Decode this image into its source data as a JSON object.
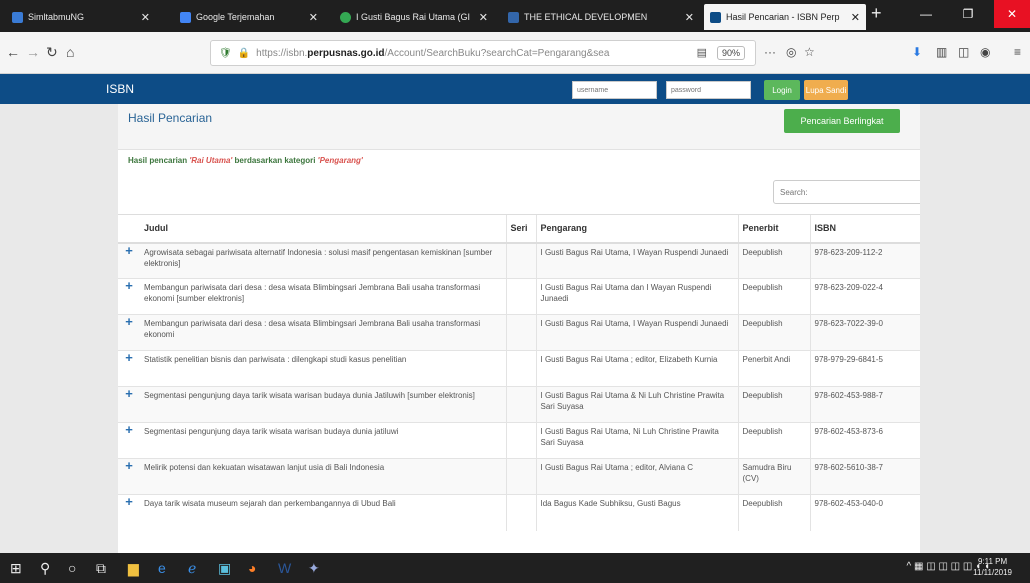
{
  "browser": {
    "tabs": [
      {
        "label": "SimltabmuNG",
        "color": "#3a7bd5"
      },
      {
        "label": "Google Terjemahan",
        "color": "#4285f4"
      },
      {
        "label": "I Gusti Bagus Rai Utama (GI",
        "color": "#34a853"
      },
      {
        "label": "THE ETHICAL DEVELOPMEN",
        "color": "#3366aa"
      },
      {
        "label": "Hasil Pencarian - ISBN Perp",
        "color": "#0d4c86"
      }
    ],
    "new_tab": "+",
    "url_host": "perpusnas.go.id",
    "url_prefix": "https://isbn.",
    "url_path": "/Account/SearchBuku?searchCat=Pengarang&sea",
    "zoom": "90%"
  },
  "header": {
    "brand": "ISBN",
    "username_placeholder": "username",
    "password_placeholder": "password",
    "login_label": "Login",
    "register_label": "Lupa Sandi"
  },
  "panel": {
    "title": "Hasil Pencarian",
    "advanced_button": "Pencarian Berlingkat",
    "result_prefix": "Hasil pencarian ",
    "result_query": "'Rai Utama'",
    "result_mid": " berdasarkan kategori ",
    "result_category": "'Pengarang'",
    "search_placeholder": "Search:"
  },
  "table": {
    "headers": {
      "judul": "Judul",
      "seri": "Seri",
      "pengarang": "Pengarang",
      "penerbit": "Penerbit",
      "isbn": "ISBN"
    },
    "rows": [
      {
        "judul": "Agrowisata sebagai pariwisata alternatif Indonesia : solusi masif pengentasan kemiskinan [sumber elektronis]",
        "seri": "",
        "pengarang": "I Gusti Bagus Rai Utama, I Wayan Ruspendi Junaedi",
        "penerbit": "Deepublish",
        "isbn": "978-623-209-112-2"
      },
      {
        "judul": "Membangun pariwisata dari desa : desa wisata Blimbingsari Jembrana Bali usaha transformasi ekonomi [sumber elektronis]",
        "seri": "",
        "pengarang": "I Gusti Bagus Rai Utama dan I Wayan Ruspendi Junaedi",
        "penerbit": "Deepublish",
        "isbn": "978-623-209-022-4"
      },
      {
        "judul": "Membangun pariwisata dari desa : desa wisata Blimbingsari Jembrana Bali usaha transformasi ekonomi",
        "seri": "",
        "pengarang": "I Gusti Bagus Rai Utama, I Wayan Ruspendi Junaedi",
        "penerbit": "Deepublish",
        "isbn": "978-623-7022-39-0"
      },
      {
        "judul": "Statistik penelitian bisnis dan pariwisata : dilengkapi studi kasus penelitian",
        "seri": "",
        "pengarang": "I Gusti Bagus Rai Utama ; editor, Elizabeth Kurnia",
        "penerbit": "Penerbit Andi",
        "isbn": "978-979-29-6841-5"
      },
      {
        "judul": "Segmentasi pengunjung daya tarik wisata warisan budaya dunia Jatiluwih [sumber elektronis]",
        "seri": "",
        "pengarang": "I Gusti Bagus Rai Utama & Ni Luh Christine Prawita Sari Suyasa",
        "penerbit": "Deepublish",
        "isbn": "978-602-453-988-7"
      },
      {
        "judul": "Segmentasi pengunjung daya tarik wisata warisan budaya dunia jatiluwi",
        "seri": "",
        "pengarang": "I Gusti Bagus Rai Utama, Ni Luh Christine Prawita Sari Suyasa",
        "penerbit": "Deepublish",
        "isbn": "978-602-453-873-6"
      },
      {
        "judul": "Melirik potensi dan kekuatan wisatawan lanjut usia di Bali Indonesia",
        "seri": "",
        "pengarang": "I Gusti Bagus Rai Utama ; editor, Alviana C",
        "penerbit": "Samudra Biru (CV)",
        "isbn": "978-602-5610-38-7"
      },
      {
        "judul": "Daya tarik wisata museum sejarah dan perkembangannya di Ubud Bali",
        "seri": "",
        "pengarang": "Ida Bagus Kade Subhiksu, Gusti Bagus",
        "penerbit": "Deepublish",
        "isbn": "978-602-453-040-0"
      }
    ]
  },
  "taskbar": {
    "time": "9:11 PM",
    "date": "11/11/2019"
  }
}
